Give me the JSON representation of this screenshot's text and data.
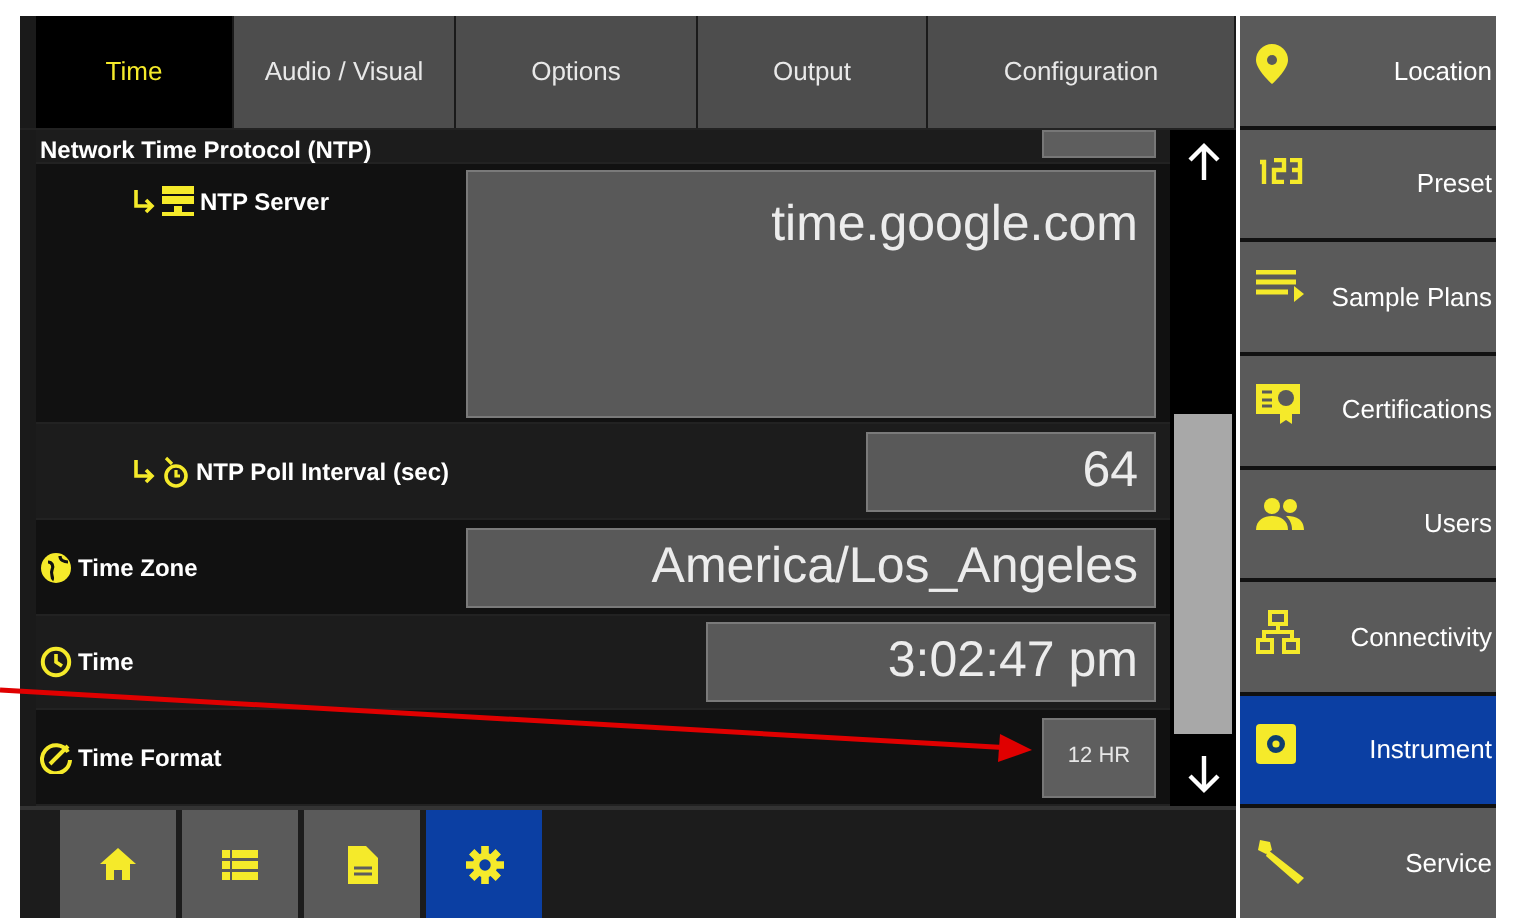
{
  "tabs": [
    {
      "label": "Time",
      "selected": true
    },
    {
      "label": "Audio / Visual",
      "selected": false
    },
    {
      "label": "Options",
      "selected": false
    },
    {
      "label": "Output",
      "selected": false
    },
    {
      "label": "Configuration",
      "selected": false
    }
  ],
  "settings": [
    {
      "label": "Network Time Protocol (NTP)",
      "kind": "button",
      "children": [
        {
          "label": "NTP Server",
          "kind": "field",
          "value": "time.google.com"
        },
        {
          "label": "NTP Poll Interval (sec)",
          "kind": "field",
          "value": "64"
        }
      ]
    },
    {
      "label": "Time Zone",
      "kind": "field",
      "value": "America/Los_Angeles"
    },
    {
      "label": "Time",
      "kind": "field",
      "value": "3:02:47 pm"
    },
    {
      "label": "Time Format",
      "kind": "button",
      "value": "12 HR"
    }
  ],
  "bottom_nav": [
    {
      "selected": false
    },
    {
      "selected": false
    },
    {
      "selected": false
    },
    {
      "selected": true
    }
  ],
  "sidebar": [
    {
      "label": "Location",
      "selected": false
    },
    {
      "label": "Preset",
      "selected": false
    },
    {
      "label": "Sample Plans",
      "selected": false
    },
    {
      "label": "Certifications",
      "selected": false
    },
    {
      "label": "Users",
      "selected": false
    },
    {
      "label": "Connectivity",
      "selected": false
    },
    {
      "label": "Instrument",
      "selected": true
    },
    {
      "label": "Service",
      "selected": false
    }
  ]
}
